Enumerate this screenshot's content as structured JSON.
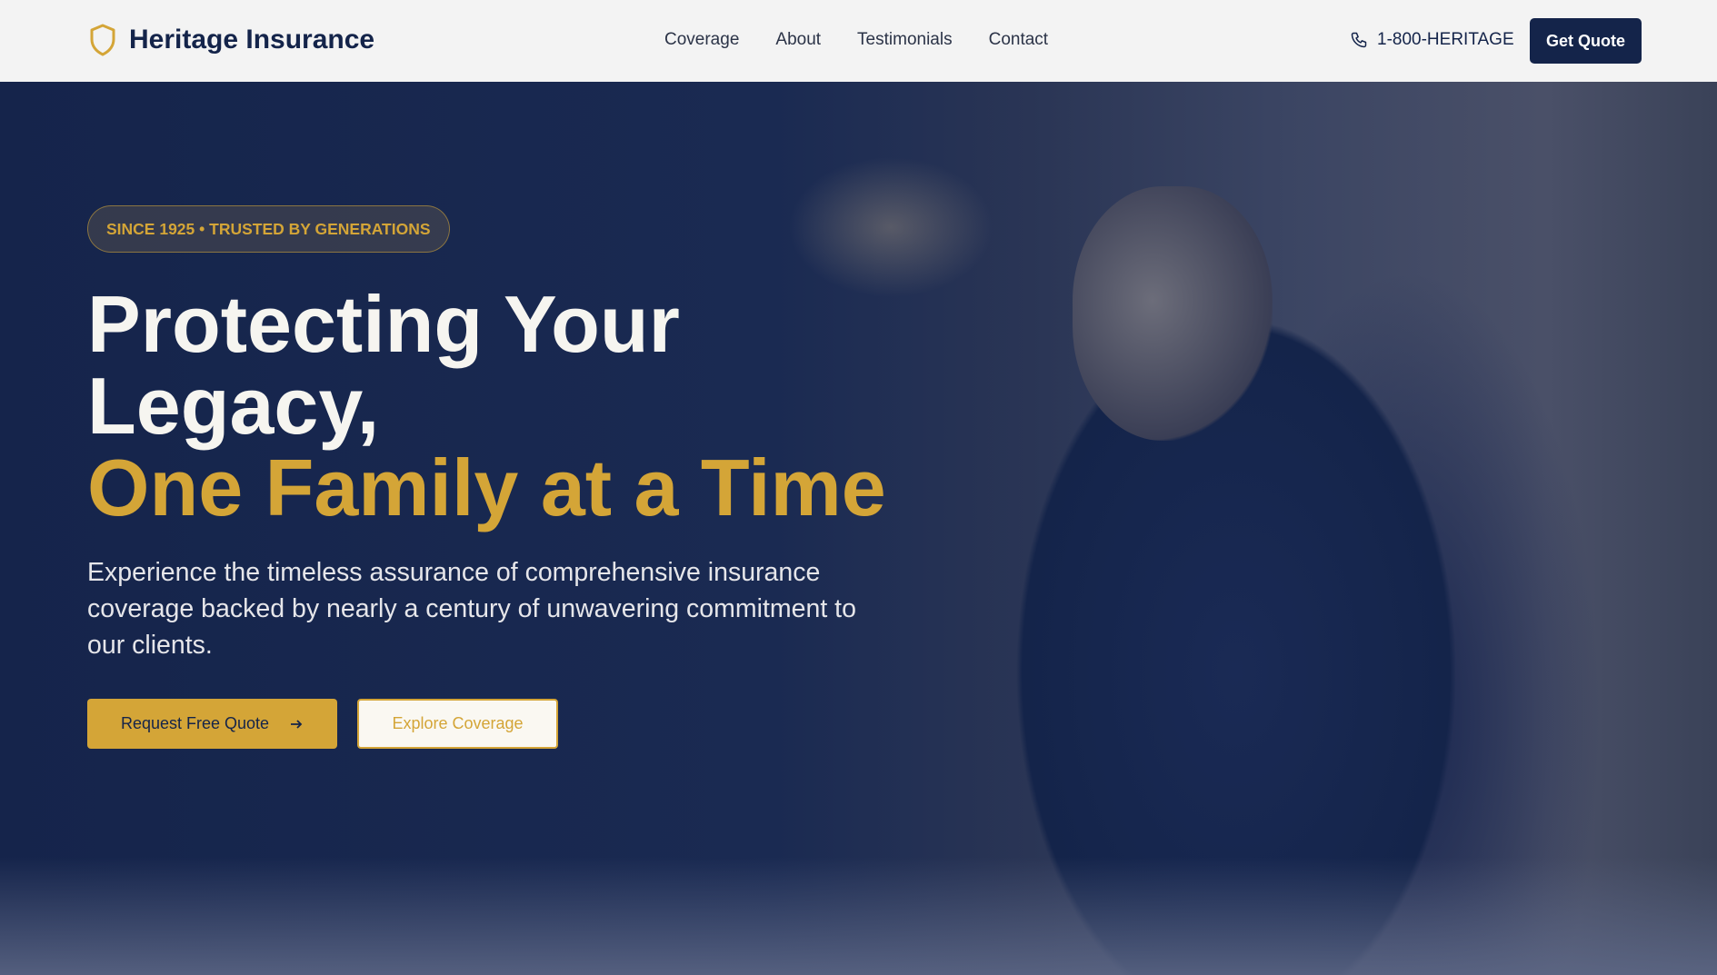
{
  "header": {
    "brand": "Heritage Insurance",
    "nav": [
      "Coverage",
      "About",
      "Testimonials",
      "Contact"
    ],
    "phone": "1-800-HERITAGE",
    "cta": "Get Quote"
  },
  "hero": {
    "badge": "SINCE 1925 • TRUSTED BY GENERATIONS",
    "title_line1": "Protecting Your",
    "title_line2": "Legacy,",
    "title_highlight": "One Family at a Time",
    "description": "Experience the timeless assurance of comprehensive insurance coverage backed by nearly a century of unwavering commitment to our clients.",
    "primary_button": "Request Free Quote",
    "secondary_button": "Explore Coverage"
  },
  "colors": {
    "navy": "#14244a",
    "gold": "#d4a537",
    "header_bg": "#f3f3f3"
  }
}
